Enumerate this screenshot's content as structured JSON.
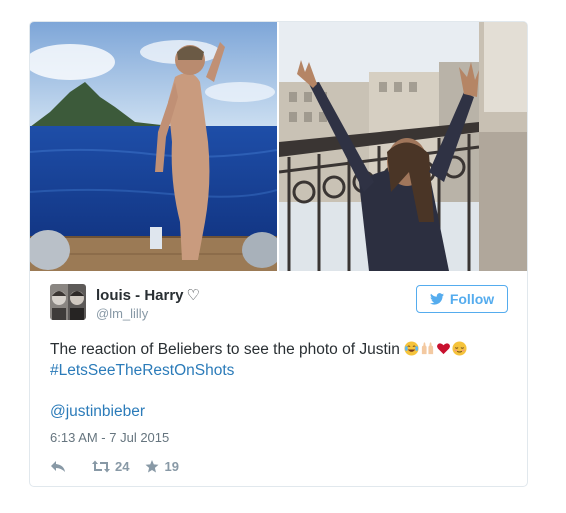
{
  "tweet": {
    "display_name": "louis - Harry",
    "name_symbol": "♡",
    "screen_name": "@lm_lilly",
    "follow_label": "Follow",
    "text": "The reaction of Beliebers to see the photo of Justin",
    "emojis": [
      "face-with-tears-of-joy",
      "raised-hands",
      "red-heart",
      "relieved-face"
    ],
    "hashtag": "#LetsSeeTheRestOnShots",
    "mention": "@justinbieber",
    "timestamp": "6:13 AM - 7 Jul 2015",
    "retweets": "24",
    "likes": "19"
  },
  "colors": {
    "link": "#2b7bb9",
    "follow": "#55acee",
    "muted": "#8899a6"
  }
}
